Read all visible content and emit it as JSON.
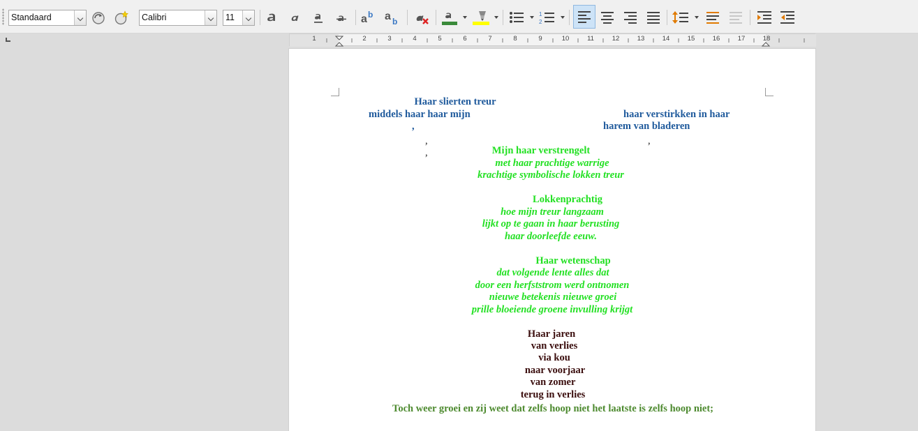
{
  "toolbar": {
    "paragraph_style": "Standaard",
    "font_name": "Calibri",
    "font_size": "11",
    "font_color": "#3a8a3a",
    "highlight_color": "#ffff00"
  },
  "ruler": {
    "numbers": [
      "1",
      "2",
      "3",
      "4",
      "5",
      "6",
      "7",
      "8",
      "9",
      "10",
      "11",
      "12",
      "13",
      "14",
      "15",
      "16",
      "17",
      "18"
    ]
  },
  "document": {
    "blue": {
      "line1": "Haar slierten treur",
      "line2_left": "middels haar haar mijn",
      "line2_right": "haar verstirkken in haar",
      "line3_left": ",",
      "line3_right": "harem van bladeren"
    },
    "commas": {
      "a": ",",
      "b": ",",
      "c": ","
    },
    "stanza1": {
      "title": "Mijn haar verstrengelt",
      "lines": [
        "met haar prachtige warrige",
        "krachtige symbolische lokken treur"
      ]
    },
    "stanza2": {
      "title": "Lokkenprachtig",
      "lines": [
        "hoe mijn treur langzaam",
        "lijkt op te gaan in haar berusting",
        "haar doorleefde eeuw."
      ]
    },
    "stanza3": {
      "title": "Haar wetenschap",
      "lines": [
        "dat volgende lente alles dat",
        "door een herfststrom werd ontnomen",
        "nieuwe betekenis nieuwe groei",
        "prille bloeiende groene invulling krijgt"
      ]
    },
    "stanza4": {
      "lines": [
        "Haar jaren",
        "van verlies",
        "via kou",
        "naar voorjaar",
        "van zomer",
        "terug in verlies"
      ]
    },
    "final": "Toch weer groei en zij weet dat zelfs hoop niet het laatste is zelfs hoop niet;"
  }
}
